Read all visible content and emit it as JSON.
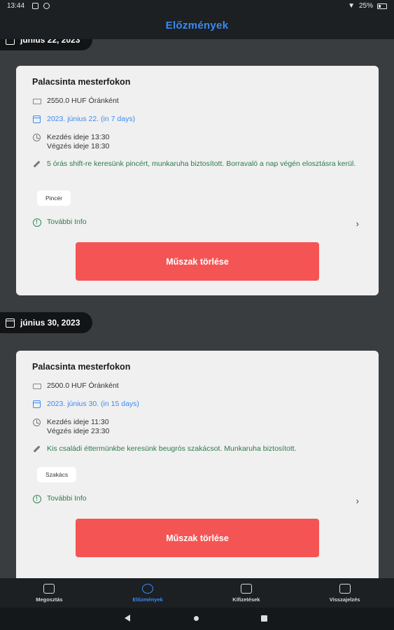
{
  "status": {
    "time": "13:44",
    "battery": "25%"
  },
  "header": {
    "title": "Előzmények"
  },
  "groups": [
    {
      "date_label": "június 22, 2023",
      "card": {
        "title": "Palacsinta mesterfokon",
        "wage": "2550.0 HUF Óránként",
        "date": "2023. június 22. (in 7 days)",
        "start": "Kezdés ideje 13:30",
        "end": "Végzés ideje 18:30",
        "description": "5 órás shift-re keresünk pincért, munkaruha biztosított. Borravaló a nap végén elosztásra kerül.",
        "tag": "Pincér",
        "info_label": "További Info",
        "delete_label": "Műszak törlése"
      }
    },
    {
      "date_label": "június 30, 2023",
      "card": {
        "title": "Palacsinta mesterfokon",
        "wage": "2500.0 HUF Óránként",
        "date": "2023. június 30. (in 15 days)",
        "start": "Kezdés ideje 11:30",
        "end": "Végzés ideje 23:30",
        "description": "Kis családi éttermünkbe keresünk beugrós szakácsot. Munkaruha biztosított.",
        "tag": "Szakács",
        "info_label": "További Info",
        "delete_label": "Műszak törlése"
      }
    }
  ],
  "nav": [
    {
      "label": "Megosztás",
      "icon": "briefcase-icon",
      "active": false
    },
    {
      "label": "Előzmények",
      "icon": "history-icon",
      "active": true
    },
    {
      "label": "Kifizetések",
      "icon": "wallet-icon",
      "active": false
    },
    {
      "label": "Visszajelzés",
      "icon": "feedback-icon",
      "active": false
    }
  ],
  "colors": {
    "accent": "#3a8af5",
    "danger": "#f55454",
    "info": "#2e7a4c",
    "bar": "#1c2023"
  }
}
